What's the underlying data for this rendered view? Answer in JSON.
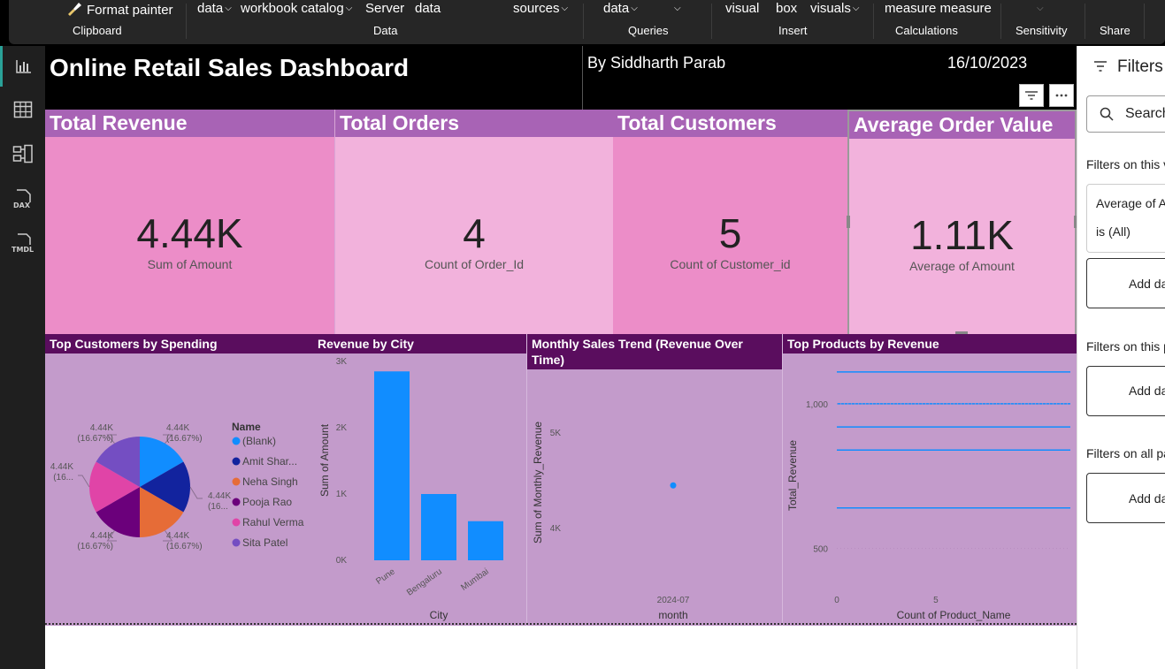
{
  "ribbon": {
    "format_painter": "Format painter",
    "clipboard_group": "Clipboard",
    "data_items": [
      "data",
      "workbook catalog",
      "Server",
      "data",
      "sources"
    ],
    "data_group": "Data",
    "queries_items": [
      "data",
      ""
    ],
    "queries_group": "Queries",
    "insert_items": [
      "visual",
      "box",
      "visuals"
    ],
    "insert_group": "Insert",
    "calc_items": [
      "measure measure"
    ],
    "calc_group": "Calculations",
    "sensitivity_group": "Sensitivity",
    "share_group": "Share"
  },
  "nav": {
    "items": [
      {
        "icon": "report-view-icon",
        "active": true
      },
      {
        "icon": "table-view-icon"
      },
      {
        "icon": "model-view-icon"
      },
      {
        "icon": "dax-query-icon",
        "text": "DAX"
      },
      {
        "icon": "tmdl-view-icon",
        "text": "TMDL"
      }
    ]
  },
  "header": {
    "title": "Online Retail Sales Dashboard",
    "author": "By Siddharth Parab",
    "date": "16/10/2023"
  },
  "kpis": [
    {
      "title": "Total Revenue",
      "value": "4.44K",
      "label": "Sum of Amount"
    },
    {
      "title": "Total Orders",
      "value": "4",
      "label": "Count of Order_Id"
    },
    {
      "title": "Total Customers",
      "value": "5",
      "label": "Count of Customer_id"
    },
    {
      "title": "Average Order Value",
      "value": "1.11K",
      "label": "Average of Amount"
    }
  ],
  "panels": {
    "pie_title": "Top Customers by Spending",
    "bar_title": "Revenue by City",
    "trend_title": "Monthly Sales Trend (Revenue Over Time)",
    "products_title": "Top Products by Revenue"
  },
  "chart_data": [
    {
      "type": "pie",
      "title": "Top Customers by Spending",
      "legend_title": "Name",
      "legend_position": "right",
      "categories": [
        "(Blank)",
        "Amit Shar...",
        "Neha Singh",
        "Pooja Rao",
        "Rahul Verma",
        "Sita Patel"
      ],
      "values": [
        4440,
        4440,
        4440,
        4440,
        4440,
        4440
      ],
      "labels": [
        "4.44K\n(16.67%)",
        "4.44K\n(16...",
        "4.44K\n(16.67%)",
        "4.44K\n(16.67%)",
        "4.44K\n(16...",
        "4.44K\n(16.67%)"
      ],
      "colors": [
        "#118dff",
        "#12239e",
        "#e66c37",
        "#6b007b",
        "#e044a7",
        "#744ec2"
      ]
    },
    {
      "type": "bar",
      "title": "Revenue by City",
      "xlabel": "City",
      "ylabel": "Sum of Amount",
      "categories": [
        "Pune",
        "Bengaluru",
        "Mumbai"
      ],
      "values": [
        2850,
        1000,
        590
      ],
      "ylim": [
        0,
        3000
      ],
      "yticks": [
        "0K",
        "1K",
        "2K",
        "3K"
      ],
      "color": "#118dff"
    },
    {
      "type": "scatter",
      "title": "Monthly Sales Trend (Revenue Over Time)",
      "xlabel": "month",
      "ylabel": "Sum of Monthly_Revenue",
      "x": [
        "2024-07"
      ],
      "y": [
        4440
      ],
      "yticks": [
        "4K",
        "5K"
      ],
      "ylim": [
        3850,
        5100
      ],
      "color": "#118dff"
    },
    {
      "type": "line",
      "title": "Top Products by Revenue",
      "xlabel": "Count of Product_Name",
      "ylabel": "Total_Revenue",
      "xticks": [
        "0",
        "5"
      ],
      "yticks": [
        "500",
        "1,000"
      ],
      "xlim": [
        0,
        11.8
      ],
      "ylim": [
        340,
        1180
      ],
      "series_y": [
        1110,
        1000,
        920,
        840,
        640
      ],
      "color": "#118dff"
    }
  ],
  "filters": {
    "title": "Filters",
    "search_placeholder": "Search",
    "on_this_visual": "Filters on this visual",
    "card_filter_line1": "Average of Amount",
    "card_filter_line2": "is (All)",
    "add_data": "Add data fields here",
    "on_this_page": "Filters on this page",
    "on_all_pages": "Filters on all pages"
  }
}
